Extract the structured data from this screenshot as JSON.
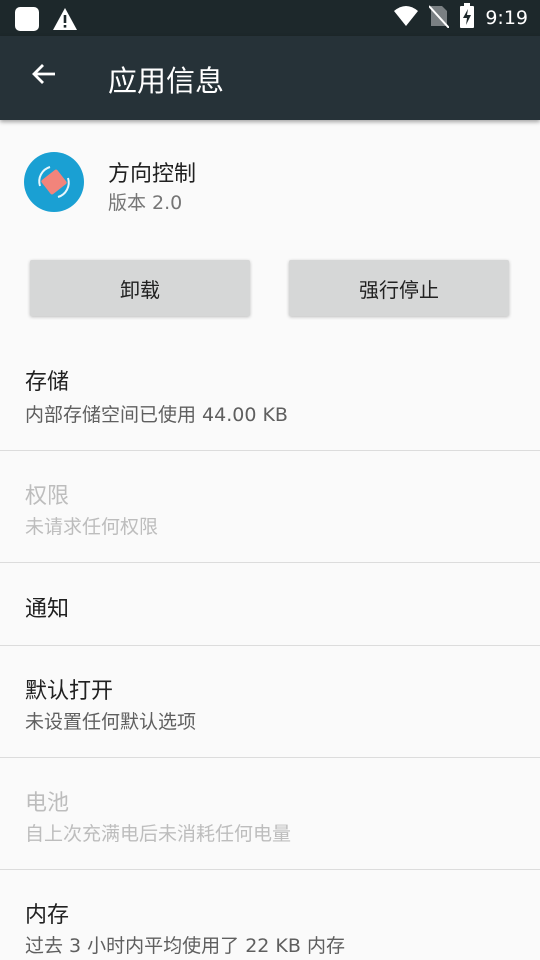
{
  "status_bar": {
    "time": "9:19"
  },
  "app_bar": {
    "title": "应用信息"
  },
  "app": {
    "name": "方向控制",
    "version": "版本 2.0"
  },
  "buttons": {
    "uninstall": "卸载",
    "force_stop": "强行停止"
  },
  "items": [
    {
      "title": "存储",
      "subtitle": "内部存储空间已使用 44.00 KB",
      "enabled": true
    },
    {
      "title": "权限",
      "subtitle": "未请求任何权限",
      "enabled": false
    },
    {
      "title": "通知",
      "subtitle": "",
      "enabled": true
    },
    {
      "title": "默认打开",
      "subtitle": "未设置任何默认选项",
      "enabled": true
    },
    {
      "title": "电池",
      "subtitle": "自上次充满电后未消耗任何电量",
      "enabled": false
    },
    {
      "title": "内存",
      "subtitle": "过去 3 小时内平均使用了 22 KB 内存",
      "enabled": true
    }
  ]
}
